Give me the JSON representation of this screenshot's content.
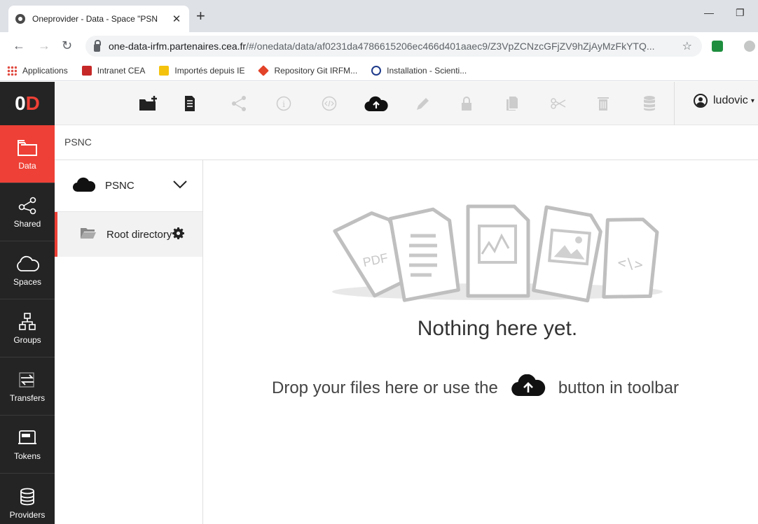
{
  "browser": {
    "tab_title": "Oneprovider - Data - Space \"PSN",
    "url_host": "one-data-irfm.partenaires.cea.fr",
    "url_path": "/#/onedata/data/af0231da4786615206ec466d401aaec9/Z3VpZCNzcGFjZV9hZjAyMzFkYTQ...",
    "bookmarks": [
      {
        "label": "Applications",
        "color": "#e04a3f"
      },
      {
        "label": "Intranet CEA",
        "color": "#c62828"
      },
      {
        "label": "Importés depuis IE",
        "color": "#f4c20d"
      },
      {
        "label": "Repository Git IRFM...",
        "color": "#e24329"
      },
      {
        "label": "Installation - Scienti...",
        "color": "#1e3a8a"
      }
    ]
  },
  "app": {
    "logo_o": "0",
    "logo_d": "D",
    "user_name": "ludovic",
    "breadcrumb": "PSNC",
    "sidebar": [
      {
        "label": "Data",
        "icon": "folder-icon"
      },
      {
        "label": "Shared",
        "icon": "share-icon"
      },
      {
        "label": "Spaces",
        "icon": "cloud-icon"
      },
      {
        "label": "Groups",
        "icon": "groups-icon"
      },
      {
        "label": "Transfers",
        "icon": "transfers-icon"
      },
      {
        "label": "Tokens",
        "icon": "token-icon"
      },
      {
        "label": "Providers",
        "icon": "database-icon"
      }
    ],
    "space_name": "PSNC",
    "root_directory": "Root directory",
    "empty_title": "Nothing here yet.",
    "empty_hint_before": "Drop your files here or use the",
    "empty_hint_after": "button in toolbar",
    "illus_pdf": "PDF",
    "accent_color": "#ee4036"
  }
}
